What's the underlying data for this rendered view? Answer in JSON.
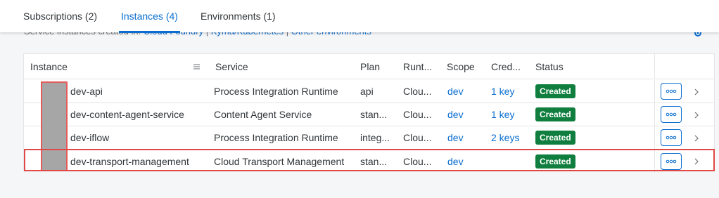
{
  "tabs": [
    {
      "label": "Subscriptions (2)"
    },
    {
      "label": "Instances (4)"
    },
    {
      "label": "Environments (1)"
    }
  ],
  "subtitle": {
    "text": "Service instances created in:",
    "links": [
      "Cloud Foundry",
      "Kyma/Kubernetes",
      "Other environments"
    ],
    "separator": "|"
  },
  "table": {
    "columns": [
      "Instance",
      "Service",
      "Plan",
      "Runt...",
      "Scope",
      "Cred...",
      "Status"
    ],
    "rows": [
      {
        "instance": "dev-api",
        "service": "Process Integration Runtime",
        "plan": "api",
        "runtime": "Clou...",
        "scope": "dev",
        "credentials": "1 key",
        "status": "Created"
      },
      {
        "instance": "dev-content-agent-service",
        "service": "Content Agent Service",
        "plan": "stan...",
        "runtime": "Clou...",
        "scope": "dev",
        "credentials": "1 key",
        "status": "Created"
      },
      {
        "instance": "dev-iflow",
        "service": "Process Integration Runtime",
        "plan": "integ...",
        "runtime": "Clou...",
        "scope": "dev",
        "credentials": "2 keys",
        "status": "Created"
      },
      {
        "instance": "dev-transport-management",
        "service": "Cloud Transport Management",
        "plan": "stan...",
        "runtime": "Clou...",
        "scope": "dev",
        "credentials": "",
        "status": "Created"
      }
    ]
  },
  "colors": {
    "accent": "#0a6ed1",
    "status_created": "#107e3e",
    "highlight": "#e04848",
    "redaction": "#a6a6a6"
  },
  "icons": {
    "sort": "sort-icon",
    "more": "more-options-icon",
    "chevron": "chevron-right-icon",
    "gear": "gear-icon"
  }
}
